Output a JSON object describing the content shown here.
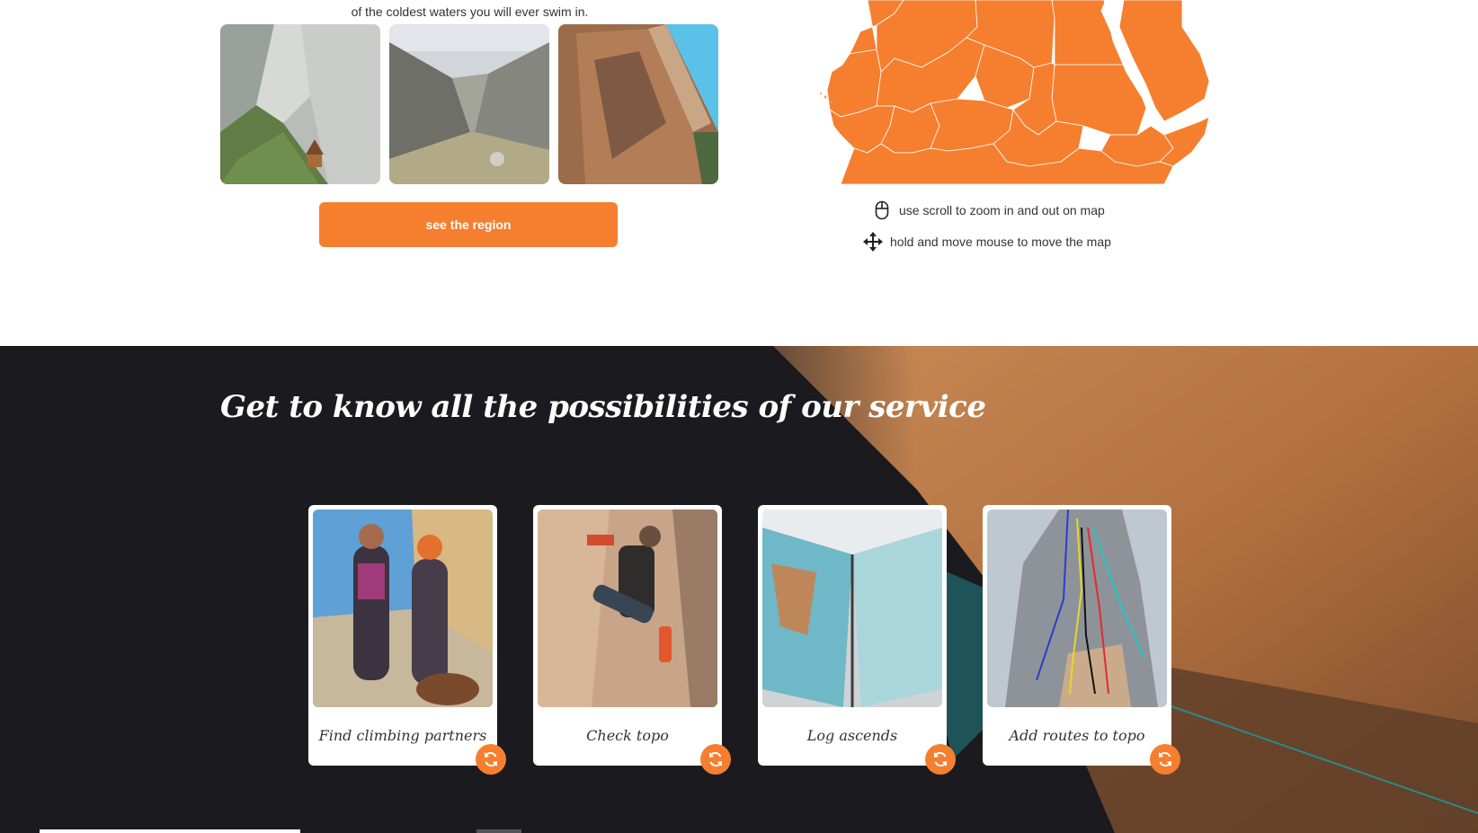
{
  "region": {
    "caption": "of the coldest waters you will ever swim in.",
    "photos": [
      "canyon-with-hut-photo",
      "rocky-valley-photo",
      "orange-cliff-photo"
    ],
    "button_label": "see the region"
  },
  "map": {
    "fill_color": "#f57f2f",
    "hints": [
      {
        "icon": "mouse-icon",
        "text": "use scroll to zoom in and out on map"
      },
      {
        "icon": "move-arrows-icon",
        "text": "hold and move mouse to move the map"
      }
    ]
  },
  "services": {
    "title": "Get to know all the possibilities of our service",
    "cards": [
      {
        "label": "Find climbing partners",
        "image": "two-climbers-photo"
      },
      {
        "label": "Check topo",
        "image": "climber-drilling-photo"
      },
      {
        "label": "Log ascends",
        "image": "open-atlas-photo"
      },
      {
        "label": "Add routes to topo",
        "image": "topo-routes-photo"
      }
    ],
    "flip_icon": "refresh-icon"
  },
  "colors": {
    "accent": "#f57f2f",
    "dark_bg": "#1b1a1f"
  }
}
